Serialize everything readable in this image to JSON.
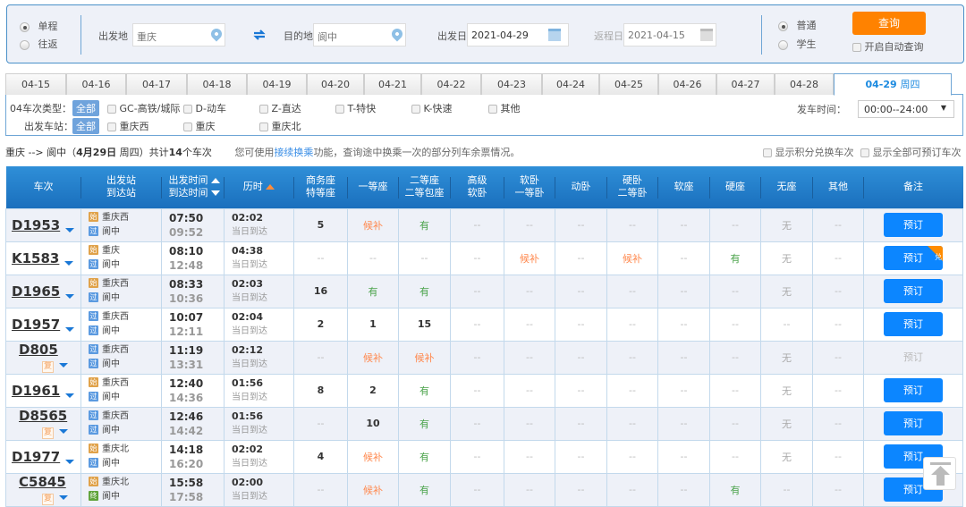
{
  "search": {
    "trip_types": [
      {
        "label": "单程",
        "selected": true
      },
      {
        "label": "往返",
        "selected": false
      }
    ],
    "from_label": "出发地",
    "from_value": "重庆",
    "to_label": "目的地",
    "to_value": "阆中",
    "depart_label": "出发日",
    "depart_value": "2021-04-29",
    "return_label": "返程日",
    "return_value": "2021-04-15",
    "passenger_types": [
      {
        "label": "普通",
        "selected": true
      },
      {
        "label": "学生",
        "selected": false
      }
    ],
    "query_button": "查询",
    "auto_query_label": "开启自动查询"
  },
  "date_tabs": [
    {
      "label": "04-15"
    },
    {
      "label": "04-16"
    },
    {
      "label": "04-17"
    },
    {
      "label": "04-18"
    },
    {
      "label": "04-19"
    },
    {
      "label": "04-20"
    },
    {
      "label": "04-21"
    },
    {
      "label": "04-22"
    },
    {
      "label": "04-23"
    },
    {
      "label": "04-24"
    },
    {
      "label": "04-25"
    },
    {
      "label": "04-26"
    },
    {
      "label": "04-27"
    },
    {
      "label": "04-28"
    },
    {
      "label": "04-29",
      "weekday": "周四",
      "active": true
    }
  ],
  "filters": {
    "train_type_label": "04车次类型：",
    "all_label": "全部",
    "train_types": [
      "GC-高铁/城际",
      "D-动车",
      "Z-直达",
      "T-特快",
      "K-快速",
      "其他"
    ],
    "station_label": "出发车站：",
    "stations": [
      "重庆西",
      "重庆",
      "重庆北"
    ],
    "depart_time_label": "发车时间：",
    "depart_time_value": "00:00--24:00"
  },
  "summary": {
    "route": "重庆 --> 阆中（",
    "date": "4月29日",
    "weekday": " 周四）共计",
    "count": "14",
    "count_suffix": "个车次",
    "tip_prefix": "您可使用",
    "tip_link": "接续换乘",
    "tip_suffix": "功能，查询途中换乘一次的部分列车余票情况。",
    "show_points": "显示积分兑换车次",
    "show_all": "显示全部可预订车次"
  },
  "table": {
    "headers": {
      "train": "车次",
      "station1": "出发站",
      "station2": "到达站",
      "time1": "出发时间",
      "time2": "到达时间",
      "duration": "历时",
      "business1": "商务座",
      "business2": "特等座",
      "first": "一等座",
      "second1": "二等座",
      "second2": "二等包座",
      "hsoft1": "高级",
      "hsoft2": "软卧",
      "soft1": "软卧",
      "soft2": "一等卧",
      "dongwo": "动卧",
      "hard1": "硬卧",
      "hard2": "二等卧",
      "softseat": "软座",
      "hardseat": "硬座",
      "noseat": "无座",
      "other": "其他",
      "remark": "备注"
    },
    "rows": [
      {
        "train": "D1953",
        "fu": false,
        "from": "重庆西",
        "from_tag": "始",
        "to": "阆中",
        "to_tag": "过",
        "dep": "07:50",
        "arr": "09:52",
        "dur": "02:02",
        "arrday": "当日到达",
        "seats": [
          "5",
          "候补",
          "有",
          "--",
          "--",
          "--",
          "--",
          "--",
          "--",
          "无",
          "--"
        ],
        "book": "预订",
        "book_enabled": true,
        "exchange": false
      },
      {
        "train": "K1583",
        "fu": false,
        "from": "重庆",
        "from_tag": "始",
        "to": "阆中",
        "to_tag": "过",
        "dep": "08:10",
        "arr": "12:48",
        "dur": "04:38",
        "arrday": "当日到达",
        "seats": [
          "--",
          "--",
          "--",
          "--",
          "候补",
          "--",
          "候补",
          "--",
          "有",
          "无",
          "--"
        ],
        "book": "预订",
        "book_enabled": true,
        "exchange": true,
        "exchange_label": "兑"
      },
      {
        "train": "D1965",
        "fu": false,
        "from": "重庆西",
        "from_tag": "始",
        "to": "阆中",
        "to_tag": "过",
        "dep": "08:33",
        "arr": "10:36",
        "dur": "02:03",
        "arrday": "当日到达",
        "seats": [
          "16",
          "有",
          "有",
          "--",
          "--",
          "--",
          "--",
          "--",
          "--",
          "无",
          "--"
        ],
        "book": "预订",
        "book_enabled": true,
        "exchange": false
      },
      {
        "train": "D1957",
        "fu": false,
        "from": "重庆西",
        "from_tag": "过",
        "to": "阆中",
        "to_tag": "过",
        "dep": "10:07",
        "arr": "12:11",
        "dur": "02:04",
        "arrday": "当日到达",
        "seats": [
          "2",
          "1",
          "15",
          "--",
          "--",
          "--",
          "--",
          "--",
          "--",
          "--",
          "--"
        ],
        "book": "预订",
        "book_enabled": true,
        "exchange": false
      },
      {
        "train": "D805",
        "fu": true,
        "fu_label": "复",
        "from": "重庆西",
        "from_tag": "过",
        "to": "阆中",
        "to_tag": "过",
        "dep": "11:19",
        "arr": "13:31",
        "dur": "02:12",
        "arrday": "当日到达",
        "seats": [
          "--",
          "候补",
          "候补",
          "--",
          "--",
          "--",
          "--",
          "--",
          "--",
          "无",
          "--"
        ],
        "book": "预订",
        "book_enabled": false,
        "exchange": false
      },
      {
        "train": "D1961",
        "fu": false,
        "from": "重庆西",
        "from_tag": "始",
        "to": "阆中",
        "to_tag": "过",
        "dep": "12:40",
        "arr": "14:36",
        "dur": "01:56",
        "arrday": "当日到达",
        "seats": [
          "8",
          "2",
          "有",
          "--",
          "--",
          "--",
          "--",
          "--",
          "--",
          "无",
          "--"
        ],
        "book": "预订",
        "book_enabled": true,
        "exchange": false
      },
      {
        "train": "D8565",
        "fu": true,
        "fu_label": "复",
        "from": "重庆西",
        "from_tag": "过",
        "to": "阆中",
        "to_tag": "过",
        "dep": "12:46",
        "arr": "14:42",
        "dur": "01:56",
        "arrday": "当日到达",
        "seats": [
          "--",
          "10",
          "有",
          "--",
          "--",
          "--",
          "--",
          "--",
          "--",
          "无",
          "--"
        ],
        "book": "预订",
        "book_enabled": true,
        "exchange": false
      },
      {
        "train": "D1977",
        "fu": false,
        "from": "重庆北",
        "from_tag": "始",
        "to": "阆中",
        "to_tag": "过",
        "dep": "14:18",
        "arr": "16:20",
        "dur": "02:02",
        "arrday": "当日到达",
        "seats": [
          "4",
          "候补",
          "有",
          "--",
          "--",
          "--",
          "--",
          "--",
          "--",
          "无",
          "--"
        ],
        "book": "预订",
        "book_enabled": true,
        "exchange": false
      },
      {
        "train": "C5845",
        "fu": true,
        "fu_label": "复",
        "from": "重庆北",
        "from_tag": "始",
        "to": "阆中",
        "to_tag": "终",
        "dep": "15:58",
        "arr": "17:58",
        "dur": "02:00",
        "arrday": "当日到达",
        "seats": [
          "--",
          "候补",
          "有",
          "--",
          "--",
          "--",
          "--",
          "--",
          "有",
          "--",
          "--"
        ],
        "book": "预订",
        "book_enabled": true,
        "exchange": false
      }
    ]
  },
  "icons": {
    "back_to_top": "arrow-up-icon"
  }
}
